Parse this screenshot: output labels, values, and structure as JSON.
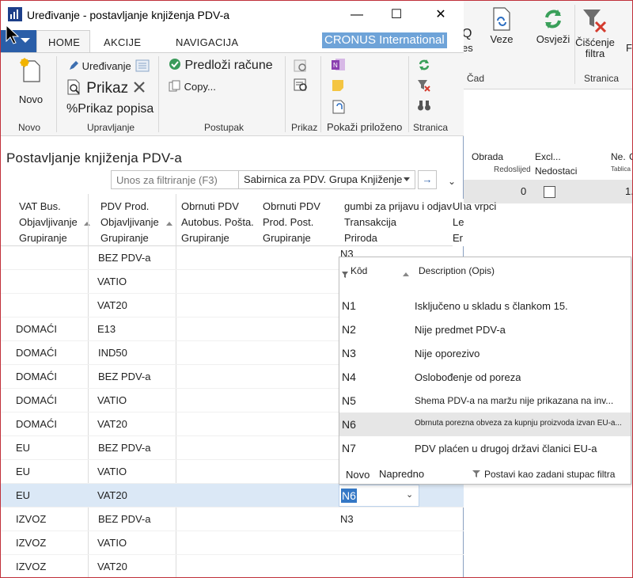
{
  "window": {
    "title": "Uređivanje - postavljanje knjiženja PDV-a",
    "minimize": "—",
    "maximize": "☐",
    "close": "✕"
  },
  "tabs": [
    {
      "label": "HOME"
    },
    {
      "label": "AKCIJE"
    },
    {
      "label": "NAVIGACIJA"
    }
  ],
  "company": "CRONUS International",
  "ribbon": {
    "novo": "Novo",
    "uredivanje": "Uređivanje",
    "prikaz": "Prikaz",
    "prikaz_popisa": "Prikaz popisa",
    "predlozi": "Predloži račune",
    "copy": "Copy...",
    "pokazi_prilozeno": "Pokaži priloženo",
    "groups": {
      "novo": "Novo",
      "upravljanje": "Upravljanje",
      "postupak": "Postupak",
      "prikaz": "Prikaz",
      "stranica": "Stranica"
    }
  },
  "background_window": {
    "ribbon": {
      "veze": "Veze",
      "osvjezi": "Osvježi",
      "ciscenje_line1": "Čišćenje",
      "ciscenje_line2": "filtra",
      "fi": "Fi",
      "es": "es",
      "cad": "Čad",
      "stranica": "Stranica",
      "q": "Q"
    },
    "grid": {
      "col_obrada": "Obrada",
      "col_redoslijed": "Redoslijed",
      "col_excl": "Excl...",
      "col_nedostaci": "Nedostaci",
      "col_ne": "Ne.",
      "col_tablica": "Tablica",
      "col_c": "C",
      "row_value": "0",
      "row_value_right": "1."
    }
  },
  "page": {
    "title": "Postavljanje knjiženja PDV-a",
    "filter_placeholder": "Unos za filtriranje (F3)",
    "filter_field": "Sabirnica za PDV. Grupa Knjiženje",
    "filter_go": "→",
    "collapse": "⌄"
  },
  "grid": {
    "headers": [
      {
        "l1": "VAT Bus.",
        "l2": "Objavljivanje",
        "l3": "Grupiranje"
      },
      {
        "l1": "PDV Prod.",
        "l2": "Objavljivanje",
        "l3": "Grupiranje"
      },
      {
        "l1": "Obrnuti PDV",
        "l2": "Autobus. Pošta.",
        "l3": "Grupiranje"
      },
      {
        "l1": "Obrnuti PDV",
        "l2": "Prod. Post.",
        "l3": "Grupiranje"
      },
      {
        "l1": "gumbi za prijavu i odjavu na vrpci",
        "l2": "Transakcija",
        "l3": "Priroda"
      }
    ],
    "extra_header": {
      "l1": "Ul",
      "l2": "Le",
      "l3": "Er"
    },
    "rows": [
      {
        "bus": "",
        "prod": "BEZ PDV-a",
        "nature": "N3"
      },
      {
        "bus": "",
        "prod": "VATIO",
        "nature": ""
      },
      {
        "bus": "",
        "prod": "VAT20",
        "nature": ""
      },
      {
        "bus": "DOMAĆI",
        "prod": "E13",
        "nature": ""
      },
      {
        "bus": "DOMAĆI",
        "prod": "IND50",
        "nature": ""
      },
      {
        "bus": "DOMAĆI",
        "prod": "BEZ PDV-a",
        "nature": ""
      },
      {
        "bus": "DOMAĆI",
        "prod": "VATIO",
        "nature": ""
      },
      {
        "bus": "DOMAĆI",
        "prod": "VAT20",
        "nature": ""
      },
      {
        "bus": "EU",
        "prod": "BEZ PDV-a",
        "nature": ""
      },
      {
        "bus": "EU",
        "prod": "VATIO",
        "nature": ""
      },
      {
        "bus": "EU",
        "prod": "VAT20",
        "nature": ""
      },
      {
        "bus": "IZVOZ",
        "prod": "BEZ PDV-a",
        "nature": "N3"
      },
      {
        "bus": "IZVOZ",
        "prod": "VATIO",
        "nature": ""
      },
      {
        "bus": "IZVOZ",
        "prod": "VAT20",
        "nature": ""
      }
    ]
  },
  "editor": {
    "value": "N6",
    "chevron": "⌄"
  },
  "lookup": {
    "header_code": "Kôd",
    "header_desc": "Description (Opis)",
    "items": [
      {
        "code": "N1",
        "desc": "Isključeno u skladu s člankom 15."
      },
      {
        "code": "N2",
        "desc": "Nije predmet PDV-a"
      },
      {
        "code": "N3",
        "desc": "Nije oporezivo"
      },
      {
        "code": "N4",
        "desc": "Oslobođenje od poreza"
      },
      {
        "code": "N5",
        "desc": "Shema PDV-a na maržu nije prikazana na inv..."
      },
      {
        "code": "N6",
        "desc": "Obrnuta porezna obveza za kupnju proizvoda izvan EU-a..."
      },
      {
        "code": "N7",
        "desc": "PDV plaćen u drugoj državi članici EU-a"
      }
    ],
    "footer_novo": "Novo",
    "footer_napredno": "Napredno",
    "footer_postavi": "Postavi kao zadani stupac filtra"
  }
}
